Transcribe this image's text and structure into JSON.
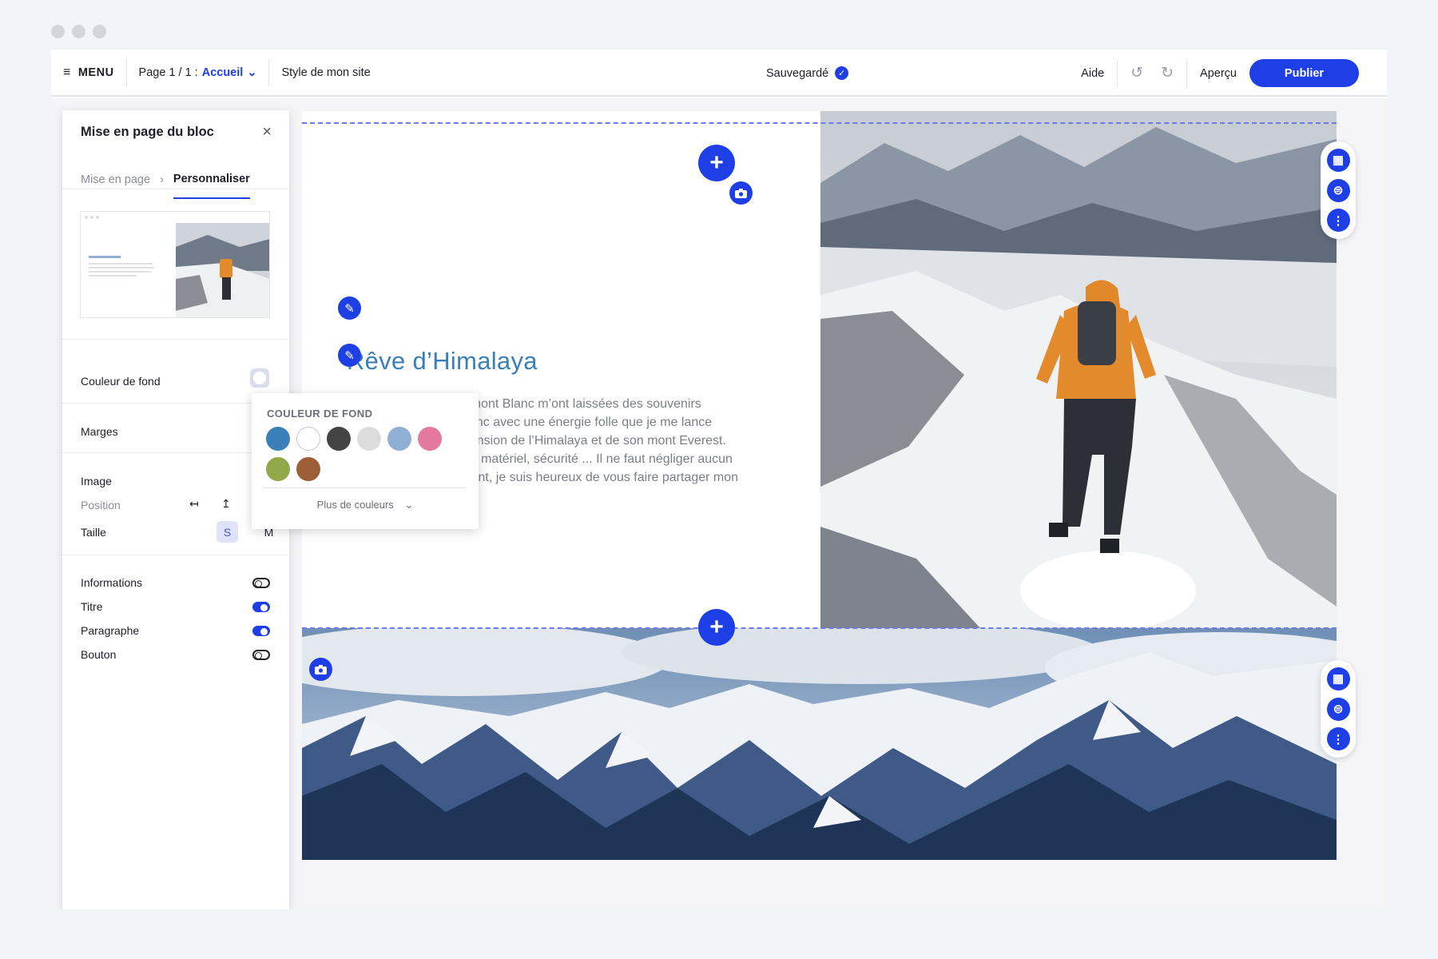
{
  "topbar": {
    "menu_label": "MENU",
    "page_prefix": "Page 1 / 1 :",
    "page_name": "Accueil",
    "site_style": "Style de mon site",
    "saved_label": "Sauvegardé",
    "help": "Aide",
    "preview": "Aperçu",
    "publish": "Publier"
  },
  "sidebar": {
    "title": "Mise en page du bloc",
    "breadcrumb": [
      "Mise en page",
      "Personnaliser"
    ],
    "rows": {
      "bg_color": "Couleur de fond",
      "margins": "Marges",
      "image": "Image",
      "position": "Position",
      "size": "Taille",
      "size_s": "S",
      "size_m": "M"
    },
    "toggles": [
      {
        "label": "Informations",
        "on": false
      },
      {
        "label": "Titre",
        "on": true
      },
      {
        "label": "Paragraphe",
        "on": true
      },
      {
        "label": "Bouton",
        "on": false
      }
    ]
  },
  "color_popup": {
    "title": "COULEUR DE FOND",
    "colors": [
      "#3b7fb8",
      "#ffffff",
      "#444444",
      "#dcdcdc",
      "#8fb0d4",
      "#e5789f",
      "#8fa84a",
      "#9c5e36"
    ],
    "more": "Plus de couleurs"
  },
  "content": {
    "title": "Rêve d’Himalaya",
    "paragraph": "Mes 5 ascensions du mont Blanc m’ont laissées des souvenirs impérissables, c’est donc avec une énergie folle que je me lance aujourd’hui dans l’ascension de l’Himalaya et de son mont Everest. Repérage du parcours, matériel, sécurité ... Il ne faut négliger aucun détail. Excité et impatient, je suis heureux de vous faire partager mon rêve !"
  }
}
